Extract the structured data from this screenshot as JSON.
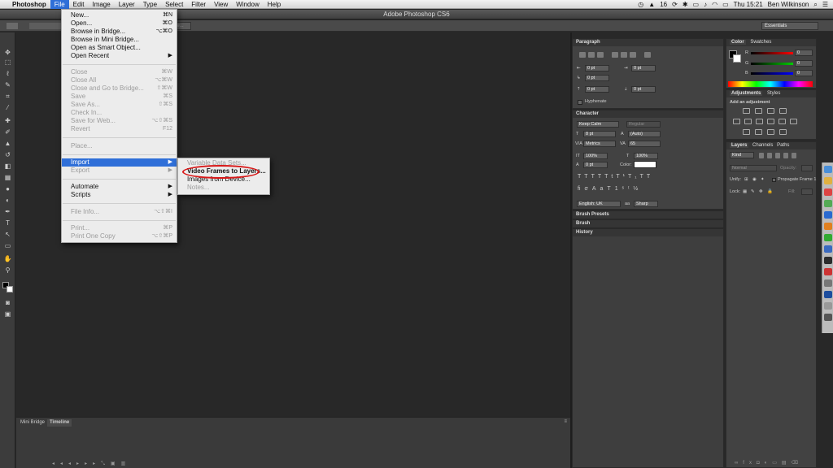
{
  "menubar": {
    "apple": "",
    "app_name": "Photoshop",
    "items": [
      "File",
      "Edit",
      "Image",
      "Layer",
      "Type",
      "Select",
      "Filter",
      "View",
      "Window",
      "Help"
    ],
    "status": {
      "battery_label": "16",
      "day_time": "Thu 15:21",
      "user": "Ben Wilkinson"
    }
  },
  "window": {
    "title": "Adobe Photoshop CS6"
  },
  "options": {
    "workspace": "Essentials",
    "refine_edge": "...ge..."
  },
  "file_menu": {
    "items": [
      {
        "label": "New...",
        "shortcut": "⌘N",
        "enabled": true
      },
      {
        "label": "Open...",
        "shortcut": "⌘O",
        "enabled": true
      },
      {
        "label": "Browse in Bridge...",
        "shortcut": "⌥⌘O",
        "enabled": true
      },
      {
        "label": "Browse in Mini Bridge...",
        "shortcut": "",
        "enabled": true
      },
      {
        "label": "Open as Smart Object...",
        "shortcut": "",
        "enabled": true
      },
      {
        "label": "Open Recent",
        "shortcut": "▶",
        "enabled": true
      },
      {
        "label": "Close",
        "shortcut": "⌘W",
        "enabled": false
      },
      {
        "label": "Close All",
        "shortcut": "⌥⌘W",
        "enabled": false
      },
      {
        "label": "Close and Go to Bridge...",
        "shortcut": "⇧⌘W",
        "enabled": false
      },
      {
        "label": "Save",
        "shortcut": "⌘S",
        "enabled": false
      },
      {
        "label": "Save As...",
        "shortcut": "⇧⌘S",
        "enabled": false
      },
      {
        "label": "Check In...",
        "shortcut": "",
        "enabled": false
      },
      {
        "label": "Save for Web...",
        "shortcut": "⌥⇧⌘S",
        "enabled": false
      },
      {
        "label": "Revert",
        "shortcut": "F12",
        "enabled": false
      },
      {
        "label": "Place...",
        "shortcut": "",
        "enabled": false
      },
      {
        "label": "Import",
        "shortcut": "▶",
        "enabled": true
      },
      {
        "label": "Export",
        "shortcut": "▶",
        "enabled": false
      },
      {
        "label": "Automate",
        "shortcut": "▶",
        "enabled": true
      },
      {
        "label": "Scripts",
        "shortcut": "▶",
        "enabled": true
      },
      {
        "label": "File Info...",
        "shortcut": "⌥⇧⌘I",
        "enabled": false
      },
      {
        "label": "Print...",
        "shortcut": "⌘P",
        "enabled": false
      },
      {
        "label": "Print One Copy",
        "shortcut": "⌥⇧⌘P",
        "enabled": false
      }
    ]
  },
  "import_submenu": {
    "items": [
      {
        "label": "Variable Data Sets...",
        "enabled": false
      },
      {
        "label": "Video Frames to Layers...",
        "enabled": true
      },
      {
        "label": "Images from Device...",
        "enabled": true
      },
      {
        "label": "Notes...",
        "enabled": false
      }
    ]
  },
  "paragraph": {
    "title": "Paragraph",
    "fields": [
      "0 pt",
      "0 pt",
      "0 pt",
      "0 pt",
      "0 pt"
    ],
    "hyphenate": "Hyphenate"
  },
  "character": {
    "title": "Character",
    "font": "Keep Calm",
    "style": "Regular",
    "size": "8 pt",
    "leading": "(Auto)",
    "kerning": "Metrics",
    "tracking": "65",
    "vscale": "100%",
    "hscale": "100%",
    "baseline": "0 pt",
    "color_label": "Color:",
    "language": "English: UK",
    "aa": "Sharp"
  },
  "color": {
    "tabs": [
      "Color",
      "Swatches"
    ],
    "r_label": "R",
    "g_label": "G",
    "b_label": "B",
    "r": "0",
    "g": "0",
    "b": "0"
  },
  "adjustments": {
    "tabs": [
      "Adjustments",
      "Styles"
    ],
    "heading": "Add an adjustment"
  },
  "layers": {
    "tabs": [
      "Layers",
      "Channels",
      "Paths"
    ],
    "kind": "Kind",
    "blend": "Normal",
    "opacity_label": "Opacity:",
    "unify": "Unify:",
    "propagate": "Propagate Frame 1",
    "lock": "Lock:",
    "fill_label": "Fill:"
  },
  "collapsed_panels": [
    "Brush Presets",
    "Brush",
    "History"
  ],
  "bottom_tabs": [
    "Mini Bridge",
    "Timeline"
  ]
}
